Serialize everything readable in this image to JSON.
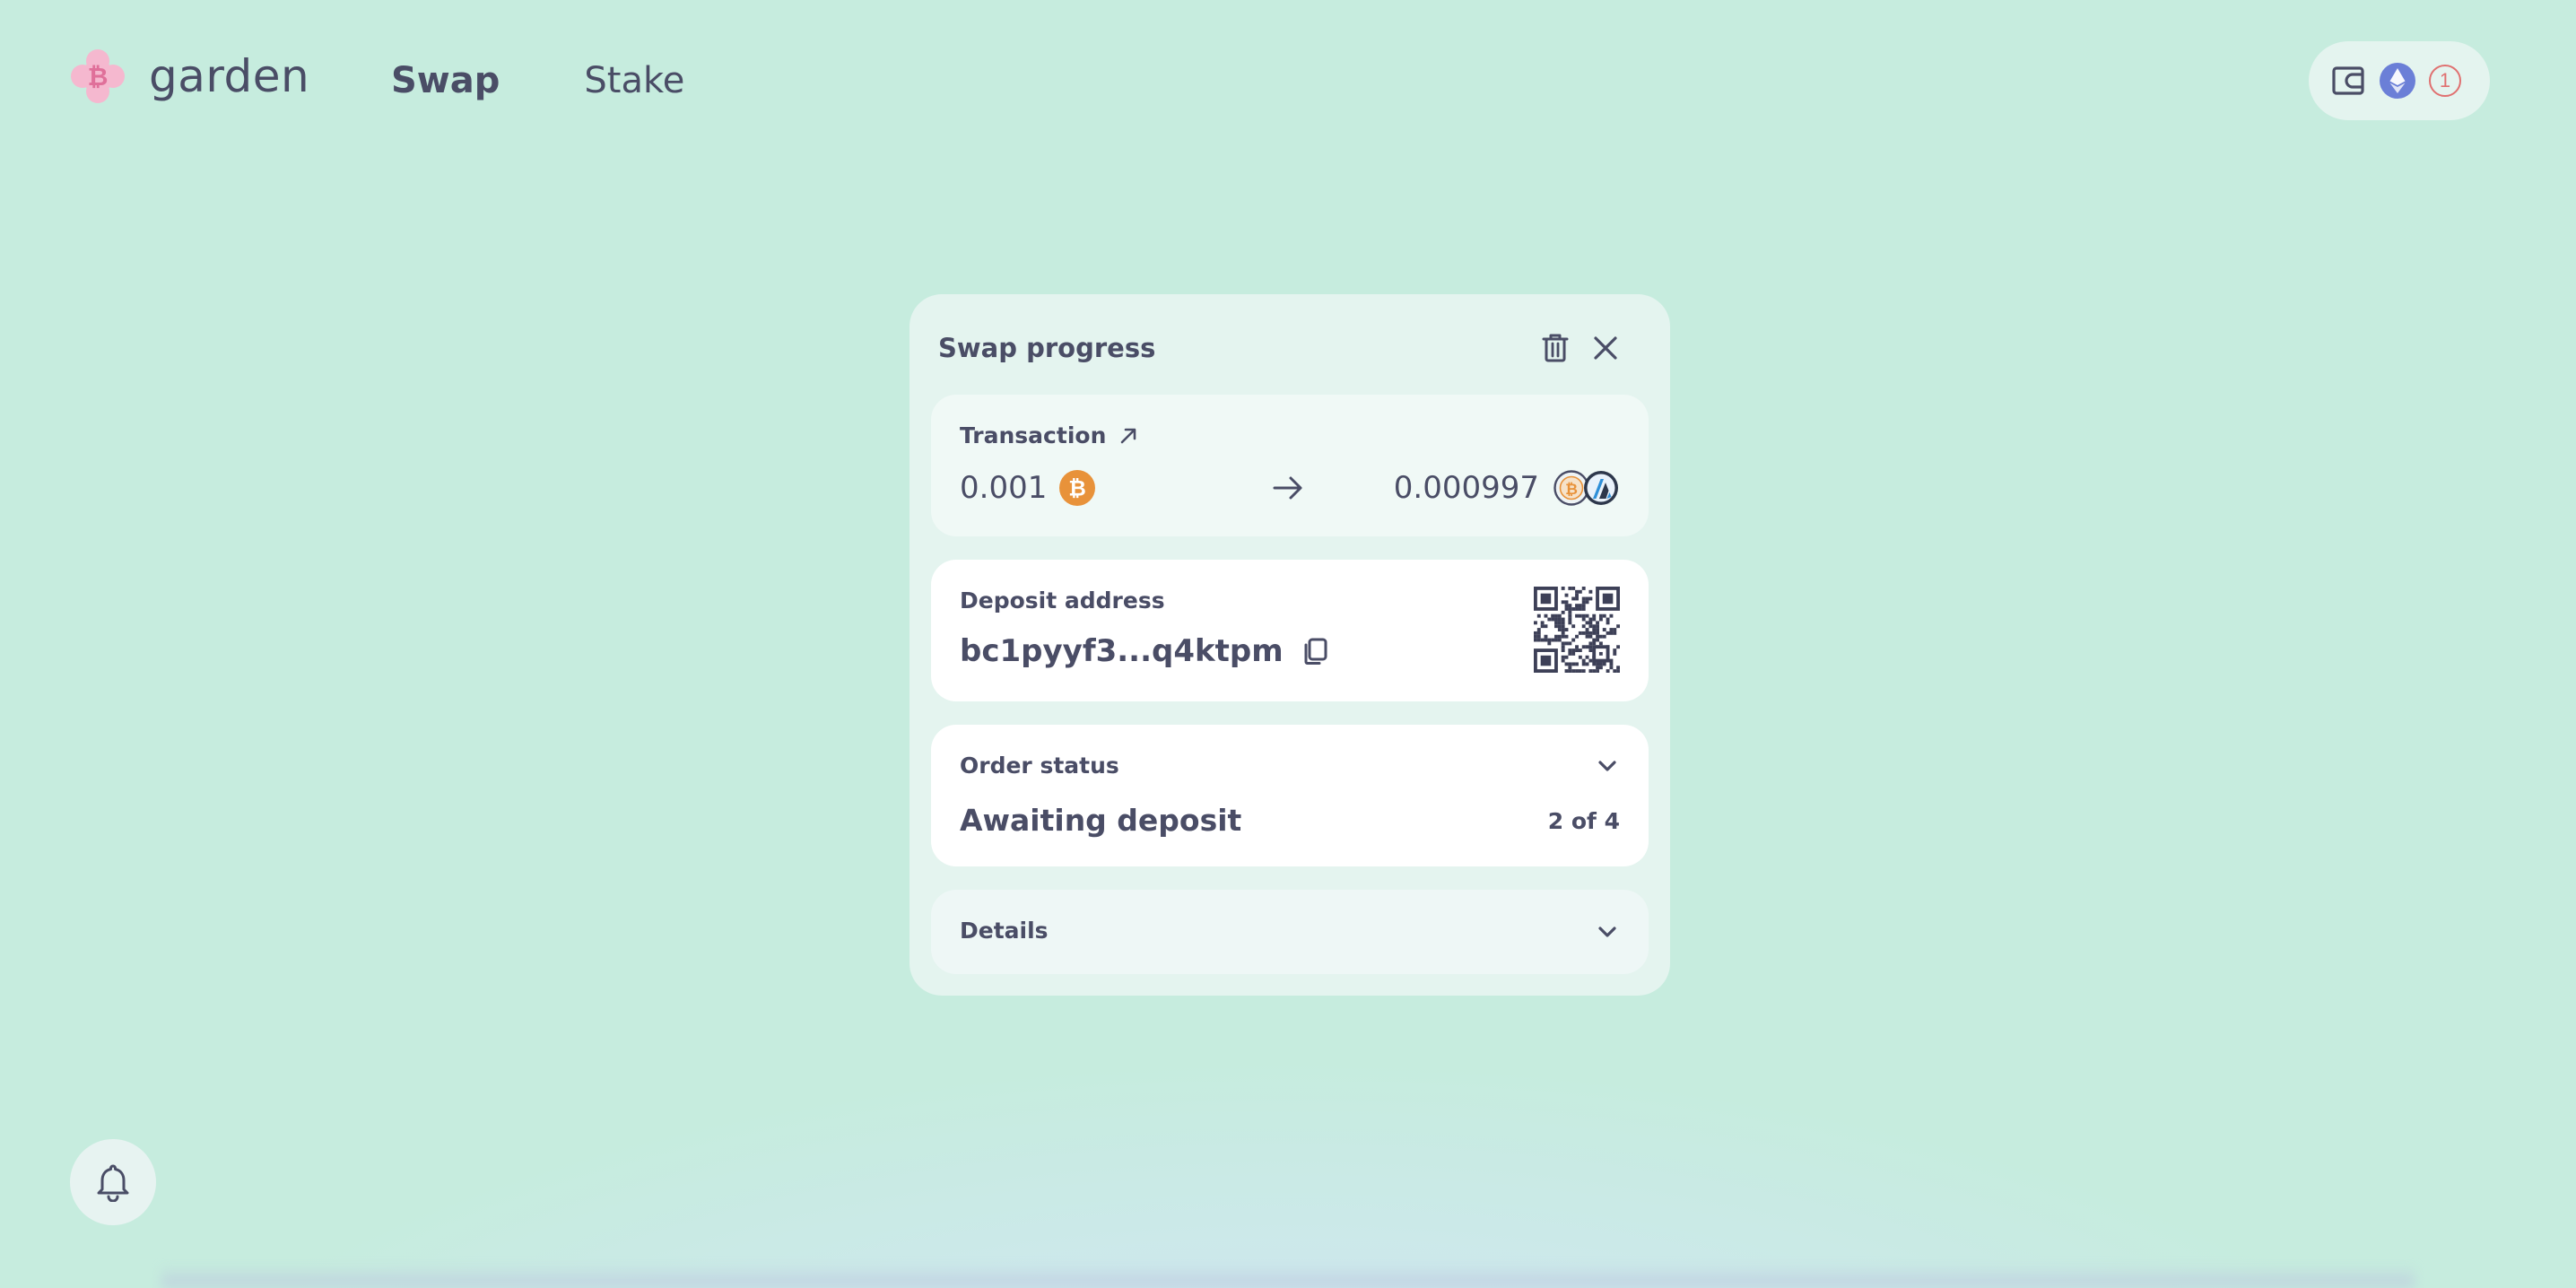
{
  "app": {
    "name": "garden",
    "brand_color": "#f0a8c4"
  },
  "nav": {
    "items": [
      {
        "label": "Swap",
        "active": true
      },
      {
        "label": "Stake",
        "active": false
      }
    ]
  },
  "wallet": {
    "icons": [
      "wallet-icon",
      "ethereum-icon",
      "pending-count-badge"
    ],
    "pending_count": "1"
  },
  "swap_card": {
    "title": "Swap progress",
    "transaction": {
      "label": "Transaction",
      "send_amount": "0.001",
      "send_asset_icon": "bitcoin-icon",
      "receive_amount": "0.000997",
      "receive_asset_icon": "wrapped-bitcoin-icon",
      "receive_chain_icon": "arbitrum-icon"
    },
    "deposit": {
      "label": "Deposit address",
      "address": "bc1pyyf3...q4ktpm"
    },
    "order_status": {
      "label": "Order status",
      "value": "Awaiting deposit",
      "step": "2 of 4"
    },
    "details": {
      "label": "Details"
    }
  },
  "colors": {
    "background": "#c6ecde",
    "card": "#e4f4ef",
    "text": "#4a4d66",
    "bitcoin": "#e8923a",
    "ethereum": "#6b7fd7",
    "badge": "#e07070"
  }
}
